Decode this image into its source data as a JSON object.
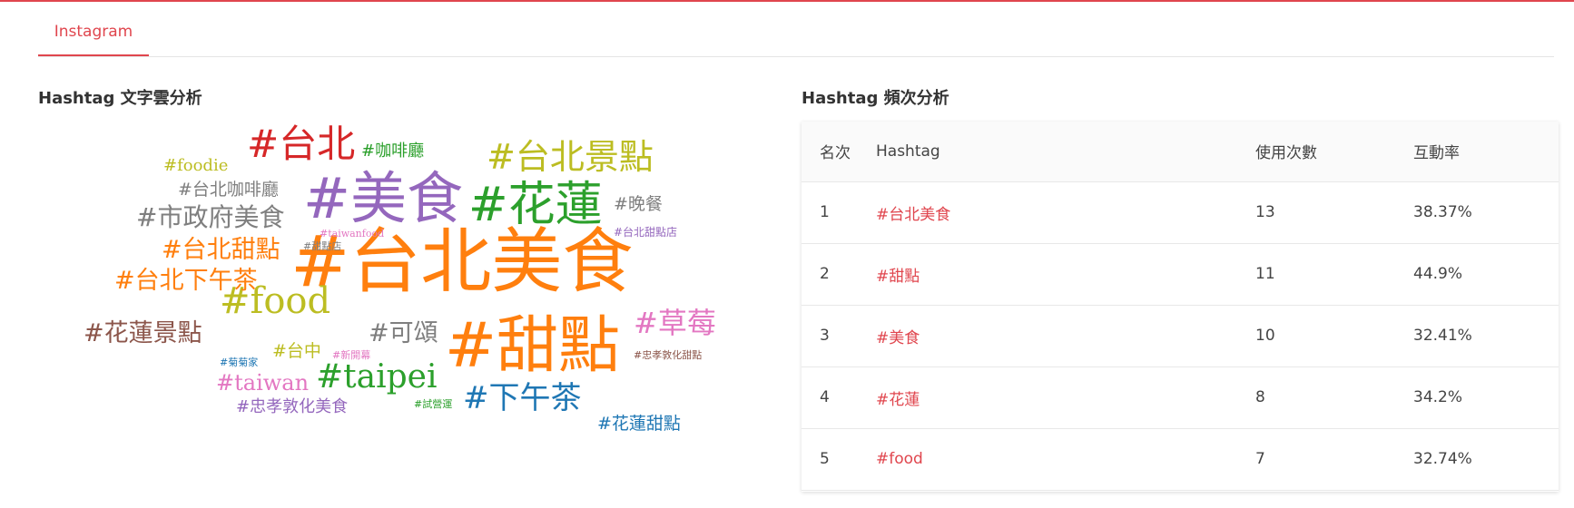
{
  "tabs": [
    {
      "label": "Instagram"
    }
  ],
  "colors": {
    "accent": "#e0464e",
    "text": "#333333"
  },
  "word_cloud": {
    "title": "Hashtag 文字雲分析",
    "words": [
      {
        "text": "#台北美食",
        "color": "#ff7f0e"
      },
      {
        "text": "#甜點",
        "color": "#ff7f0e"
      },
      {
        "text": "#美食",
        "color": "#9467bd"
      },
      {
        "text": "#花蓮",
        "color": "#2ca02c"
      },
      {
        "text": "#台北",
        "color": "#d62728"
      },
      {
        "text": "#台北景點",
        "color": "#bcbd22"
      },
      {
        "text": "#food",
        "color": "#bcbd22"
      },
      {
        "text": "#taipei",
        "color": "#2ca02c"
      },
      {
        "text": "#下午茶",
        "color": "#1f77b4"
      },
      {
        "text": "#草莓",
        "color": "#e377c2"
      },
      {
        "text": "#市政府美食",
        "color": "#7f7f7f"
      },
      {
        "text": "#台北甜點",
        "color": "#ff7f0e"
      },
      {
        "text": "#台北下午茶",
        "color": "#ff7f0e"
      },
      {
        "text": "#花蓮景點",
        "color": "#8c564b"
      },
      {
        "text": "#可頌",
        "color": "#7f7f7f"
      },
      {
        "text": "#taiwan",
        "color": "#e377c2"
      },
      {
        "text": "#台中",
        "color": "#bcbd22"
      },
      {
        "text": "#咖啡廳",
        "color": "#2ca02c"
      },
      {
        "text": "#foodie",
        "color": "#bcbd22"
      },
      {
        "text": "#台北咖啡廳",
        "color": "#7f7f7f"
      },
      {
        "text": "#晚餐",
        "color": "#7f7f7f"
      },
      {
        "text": "#忠孝敦化美食",
        "color": "#9467bd"
      },
      {
        "text": "#花蓮甜點",
        "color": "#1f77b4"
      },
      {
        "text": "#taiwanfood",
        "color": "#e377c2"
      },
      {
        "text": "#甜點店",
        "color": "#7f7f7f"
      },
      {
        "text": "#台北甜點店",
        "color": "#9467bd"
      },
      {
        "text": "#菊菊家",
        "color": "#1f77b4"
      },
      {
        "text": "#新開幕",
        "color": "#e377c2"
      },
      {
        "text": "#忠孝敦化甜點",
        "color": "#8c564b"
      },
      {
        "text": "#試營運",
        "color": "#2ca02c"
      }
    ]
  },
  "frequency": {
    "title": "Hashtag 頻次分析",
    "columns": [
      "名次",
      "Hashtag",
      "使用次數",
      "互動率"
    ],
    "rows": [
      {
        "rank": "1",
        "tag": "#台北美食",
        "count": "13",
        "rate": "38.37%"
      },
      {
        "rank": "2",
        "tag": "#甜點",
        "count": "11",
        "rate": "44.9%"
      },
      {
        "rank": "3",
        "tag": "#美食",
        "count": "10",
        "rate": "32.41%"
      },
      {
        "rank": "4",
        "tag": "#花蓮",
        "count": "8",
        "rate": "34.2%"
      },
      {
        "rank": "5",
        "tag": "#food",
        "count": "7",
        "rate": "32.74%"
      }
    ]
  }
}
